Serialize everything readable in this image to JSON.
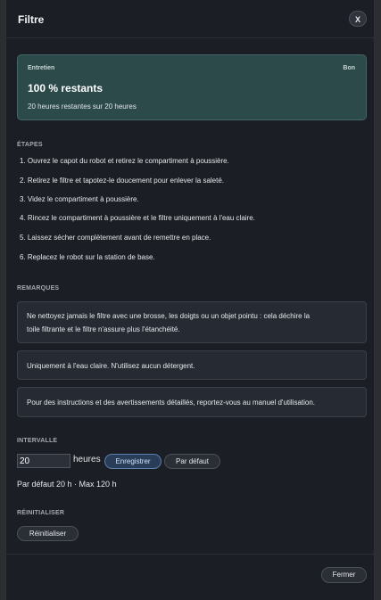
{
  "dialog": {
    "title": "Filtre",
    "close_label": "X"
  },
  "status": {
    "label": "Entretien",
    "badge": "Bon",
    "remaining": "100 % restants",
    "detail": "20 heures restantes sur 20 heures"
  },
  "steps": {
    "title": "ÉTAPES",
    "items": [
      "1. Ouvrez le capot du robot et retirez le compartiment à poussière.",
      "2. Retirez le filtre et tapotez-le doucement pour enlever la saleté.",
      "3. Videz le compartiment à poussière.",
      "4. Rincez le compartiment à poussière et le filtre uniquement à l'eau claire.",
      "5. Laissez sécher complètement avant de remettre en place.",
      "6. Replacez le robot sur la station de base."
    ]
  },
  "remarks": {
    "title": "REMARQUES",
    "notes": [
      [
        "Ne nettoyez jamais le filtre avec une brosse, les doigts ou un objet pointu : cela déchire la",
        "toile filtrante et le filtre n'assure plus l'étanchéité."
      ],
      [
        "Uniquement à l'eau claire. N'utilisez aucun détergent."
      ],
      [
        "Pour des instructions et des avertissements détaillés, reportez-vous au manuel d'utilisation."
      ]
    ]
  },
  "interval": {
    "title": "INTERVALLE",
    "value": "20",
    "unit": "heures",
    "save_label": "Enregistrer",
    "default_label": "Par défaut",
    "defaults_text": "Par défaut 20 h · Max 120 h"
  },
  "reset": {
    "title": "RÉINITIALISER",
    "button_label": "Réinitialiser"
  },
  "footer": {
    "close_label": "Fermer"
  }
}
